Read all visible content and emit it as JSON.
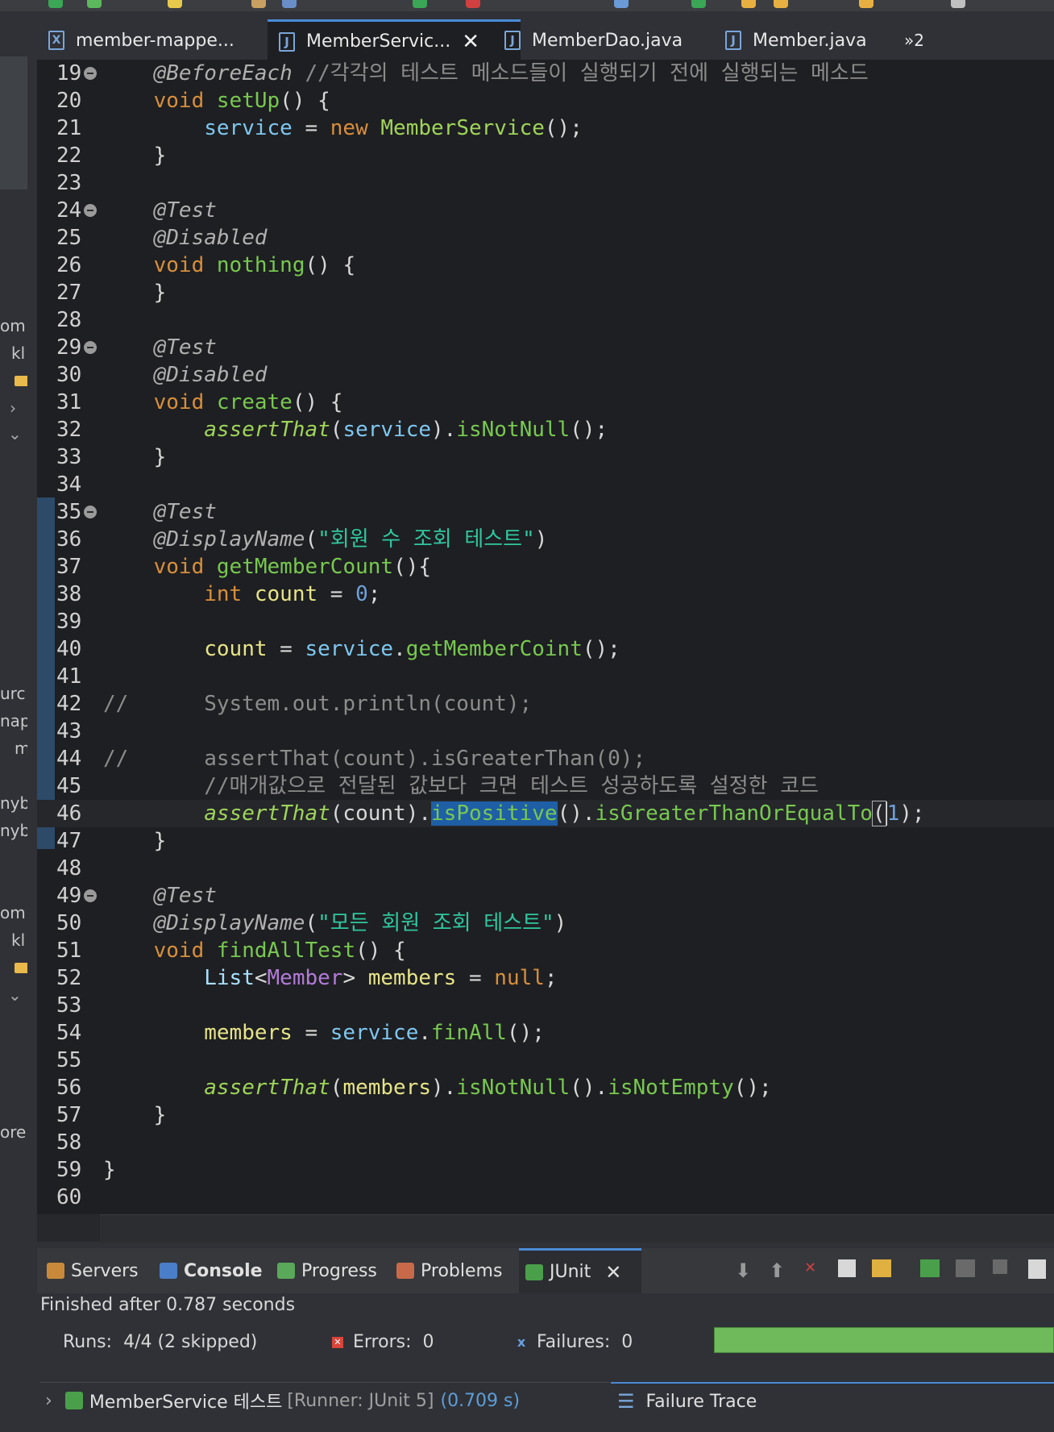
{
  "tabs": [
    {
      "label": "member-mappe...",
      "icon": "xml-file-icon"
    },
    {
      "label": "MemberServic...",
      "icon": "java-file-icon",
      "active": true
    },
    {
      "label": "MemberDao.java",
      "icon": "java-file-icon"
    },
    {
      "label": "Member.java",
      "icon": "java-file-icon"
    }
  ],
  "tab_overflow": "»2",
  "left_fragments": [
    "om",
    "kl",
    "urc",
    "nap",
    "m",
    "nyb",
    "nyb",
    "om",
    "kl",
    "ore"
  ],
  "lines": {
    "l19": {
      "num": "19",
      "ann": "@BeforeEach",
      "cmt": " //각각의 테스트 메소드들이 실행되기 전에 실행되는 메소드"
    },
    "l20": {
      "num": "20",
      "kw": "void",
      "fn": "setUp",
      "rest": "() {"
    },
    "l21": {
      "num": "21",
      "fld": "service",
      "eq": " = ",
      "kw": "new",
      "typ": "MemberService",
      "rest": "();"
    },
    "l22": {
      "num": "22",
      "rest": "}"
    },
    "l23": {
      "num": "23"
    },
    "l24": {
      "num": "24",
      "ann": "@Test"
    },
    "l25": {
      "num": "25",
      "ann": "@Disabled"
    },
    "l26": {
      "num": "26",
      "kw": "void",
      "fn": "nothing",
      "rest": "() {"
    },
    "l27": {
      "num": "27",
      "rest": "}"
    },
    "l28": {
      "num": "28"
    },
    "l29": {
      "num": "29",
      "ann": "@Test"
    },
    "l30": {
      "num": "30",
      "ann": "@Disabled"
    },
    "l31": {
      "num": "31",
      "kw": "void",
      "fn": "create",
      "rest": "() {"
    },
    "l32": {
      "num": "32",
      "st": "assertThat",
      "p1": "(",
      "fld": "service",
      "p2": ").",
      "fn": "isNotNull",
      "rest": "();"
    },
    "l33": {
      "num": "33",
      "rest": "}"
    },
    "l34": {
      "num": "34"
    },
    "l35": {
      "num": "35",
      "ann": "@Test"
    },
    "l36": {
      "num": "36",
      "ann": "@DisplayName",
      "p1": "(",
      "str": "\"회원 수 조회 테스트\"",
      "rest": ")"
    },
    "l37": {
      "num": "37",
      "kw": "void",
      "fn": "getMemberCount",
      "rest": "(){"
    },
    "l38": {
      "num": "38",
      "kw": "int",
      "var": "count",
      "eq": " = ",
      "num_val": "0",
      "rest": ";"
    },
    "l39": {
      "num": "39"
    },
    "l40": {
      "num": "40",
      "var": "count",
      "eq": " = ",
      "fld": "service",
      "dot": ".",
      "fn": "getMemberCoint",
      "rest": "();"
    },
    "l41": {
      "num": "41"
    },
    "l42": {
      "num": "42",
      "cmt": "//      System.out.println(count);"
    },
    "l43": {
      "num": "43"
    },
    "l44": {
      "num": "44",
      "cmt": "//      assertThat(count).isGreaterThan(0);"
    },
    "l45": {
      "num": "45",
      "cmt": "//매개값으로 전달된 값보다 크면 테스트 성공하도록 설정한 코드"
    },
    "l46": {
      "num": "46",
      "st": "assertThat",
      "a": "(count).",
      "sel": "isPositive",
      "b": "().",
      "fn": "isGreaterThanOrEqualTo",
      "p1": "(",
      "num_val": "1",
      "rest": ");"
    },
    "l47": {
      "num": "47",
      "rest": "}"
    },
    "l48": {
      "num": "48"
    },
    "l49": {
      "num": "49",
      "ann": "@Test"
    },
    "l50": {
      "num": "50",
      "ann": "@DisplayName",
      "p1": "(",
      "str": "\"모든 회원 조회 테스트\"",
      "rest": ")"
    },
    "l51": {
      "num": "51",
      "kw": "void",
      "fn": "findAllTest",
      "rest": "() {"
    },
    "l52": {
      "num": "52",
      "typ": "List",
      "lt": "<",
      "gen": "Member",
      "gt": "> ",
      "var": "members",
      "eq": " = ",
      "kw": "null",
      "rest": ";"
    },
    "l53": {
      "num": "53"
    },
    "l54": {
      "num": "54",
      "var": "members",
      "eq": " = ",
      "fld": "service",
      "dot": ".",
      "fn": "finAll",
      "rest": "();"
    },
    "l55": {
      "num": "55"
    },
    "l56": {
      "num": "56",
      "st": "assertThat",
      "p1": "(",
      "var": "members",
      "p2": ").",
      "fn": "isNotNull",
      "mid": "().",
      "fn2": "isNotEmpty",
      "rest": "();"
    },
    "l57": {
      "num": "57",
      "rest": "}"
    },
    "l58": {
      "num": "58"
    },
    "l59": {
      "num": "59",
      "rest": "}"
    },
    "l60": {
      "num": "60"
    }
  },
  "panel": {
    "tabs": [
      {
        "label": "Servers"
      },
      {
        "label": "Console"
      },
      {
        "label": "Progress"
      },
      {
        "label": "Problems"
      },
      {
        "label": "JUnit",
        "active": true
      }
    ],
    "finished": "Finished after 0.787 seconds",
    "runs_label": "Runs:",
    "runs_value": "4/4 (2 skipped)",
    "errors_label": "Errors:",
    "errors_value": "0",
    "failures_label": "Failures:",
    "failures_value": "0",
    "progress_fraction": 1.0,
    "progress_color": "#6fba5a",
    "tree_item": "MemberService 테스트",
    "tree_runner": "[Runner: JUnit 5]",
    "tree_time": "(0.709 s)",
    "failure_trace": "Failure Trace"
  },
  "colors": {
    "editor_bg": "#1e1f22",
    "keyword": "#d88f3b",
    "method": "#78c850",
    "string": "#2fc8a0",
    "comment": "#8c8c8c",
    "accent": "#4a8ad6"
  }
}
